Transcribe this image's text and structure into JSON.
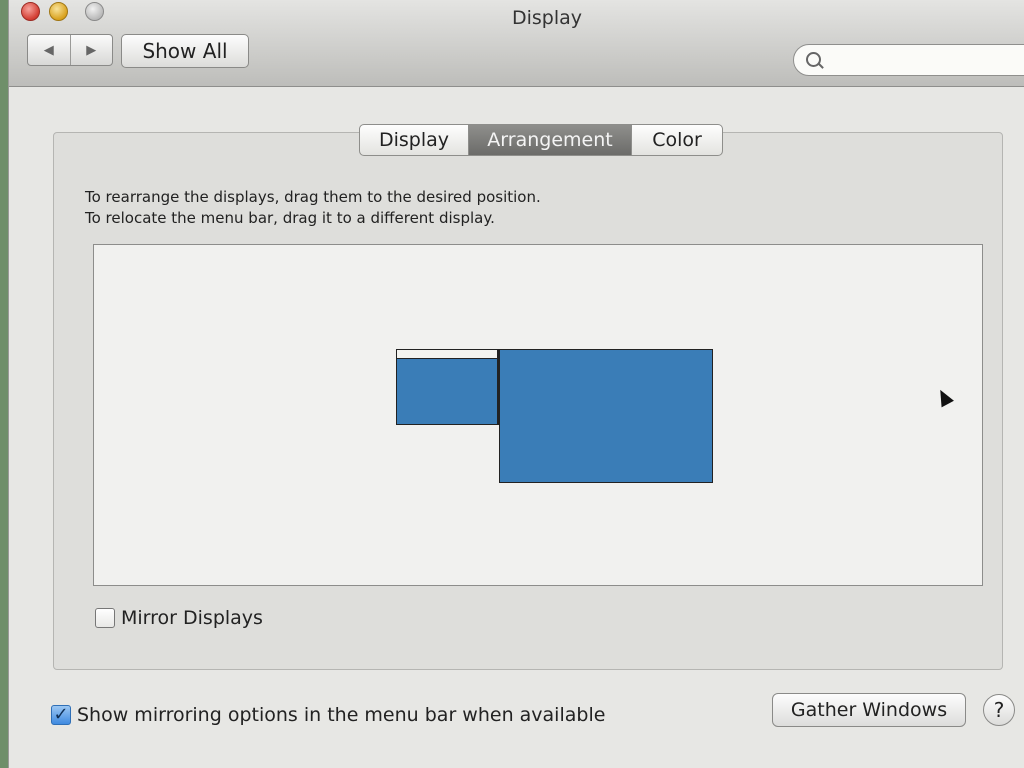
{
  "window": {
    "title": "Display",
    "colors": {
      "traffic_close": "#d23c31",
      "traffic_minimize": "#d9a11d",
      "traffic_zoom": "#b9b9b9",
      "display_blue": "#3a7db7",
      "checkbox_blue": "#3f8ae0"
    }
  },
  "toolbar": {
    "back_icon": "◀",
    "forward_icon": "▶",
    "show_all_label": "Show All",
    "search_placeholder": ""
  },
  "tabs": [
    {
      "label": "Display",
      "active": false
    },
    {
      "label": "Arrangement",
      "active": true
    },
    {
      "label": "Color",
      "active": false
    }
  ],
  "instructions": {
    "line1": "To rearrange the displays, drag them to the desired position.",
    "line2": "To relocate the menu bar, drag it to a different display."
  },
  "arrangement": {
    "displays": [
      {
        "id": "display-1",
        "has_menu_bar": true
      },
      {
        "id": "display-2",
        "has_menu_bar": false
      }
    ]
  },
  "options": {
    "mirror_displays_label": "Mirror Displays",
    "mirror_displays_checked": false,
    "show_mirroring_label": "Show mirroring options in the menu bar when available",
    "show_mirroring_checked": true
  },
  "buttons": {
    "gather_windows_label": "Gather Windows",
    "help_label": "?"
  }
}
